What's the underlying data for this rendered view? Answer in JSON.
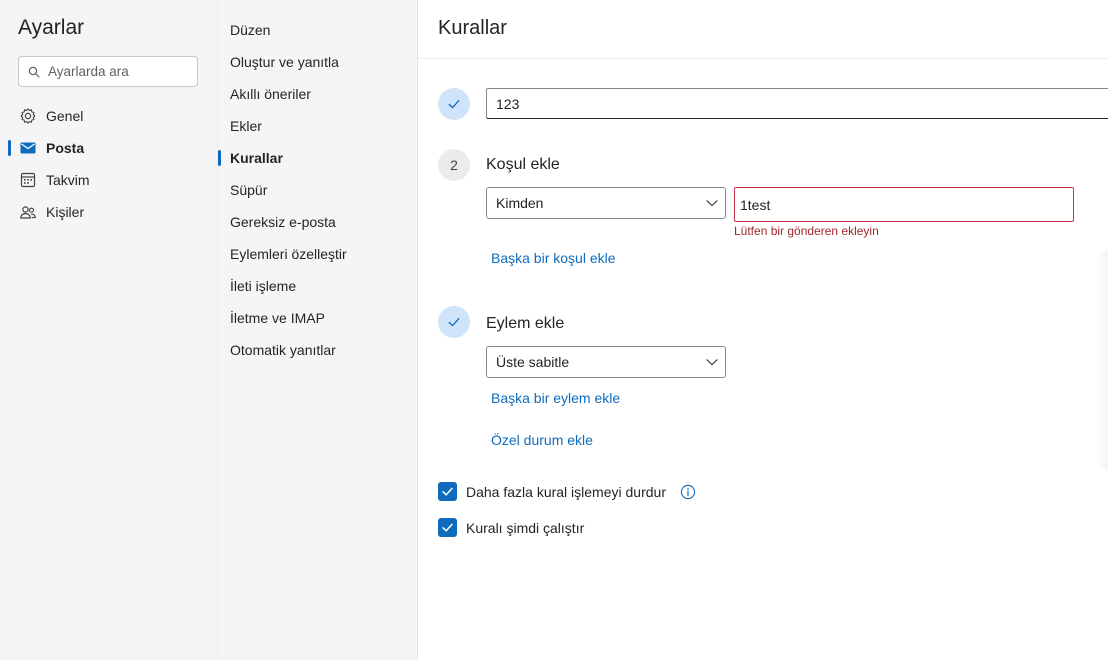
{
  "settings": {
    "title": "Ayarlar",
    "search_placeholder": "Ayarlarda ara"
  },
  "categories": [
    {
      "label": "Genel",
      "icon": "gear-icon",
      "active": false
    },
    {
      "label": "Posta",
      "icon": "mail-icon",
      "active": true
    },
    {
      "label": "Takvim",
      "icon": "calendar-icon",
      "active": false
    },
    {
      "label": "Kişiler",
      "icon": "people-icon",
      "active": false
    }
  ],
  "subnav": [
    {
      "label": "Düzen",
      "active": false
    },
    {
      "label": "Oluştur ve yanıtla",
      "active": false
    },
    {
      "label": "Akıllı öneriler",
      "active": false
    },
    {
      "label": "Ekler",
      "active": false
    },
    {
      "label": "Kurallar",
      "active": true
    },
    {
      "label": "Süpür",
      "active": false
    },
    {
      "label": "Gereksiz e-posta",
      "active": false
    },
    {
      "label": "Eylemleri özelleştir",
      "active": false
    },
    {
      "label": "İleti işleme",
      "active": false
    },
    {
      "label": "İletme ve IMAP",
      "active": false
    },
    {
      "label": "Otomatik yanıtlar",
      "active": false
    }
  ],
  "main": {
    "title": "Kurallar",
    "rule_name_value": "123",
    "condition": {
      "step_number": "2",
      "label": "Koşul ekle",
      "dropdown_value": "Kimden",
      "input_value": "1test",
      "error_text": "Lütfen bir gönderen ekleyin",
      "add_link": "Başka bir koşul ekle"
    },
    "action": {
      "label": "Eylem ekle",
      "dropdown_value": "Üste sabitle",
      "add_link": "Başka bir eylem ekle",
      "exception_link": "Özel durum ekle"
    },
    "checkboxes": [
      {
        "label": "Daha fazla kural işlemeyi durdur",
        "checked": true,
        "has_info": true
      },
      {
        "label": "Kuralı şimdi çalıştır",
        "checked": true,
        "has_info": false
      }
    ]
  },
  "colors": {
    "accent": "#0f6cbd",
    "error": "#c4314b",
    "step_done_bg": "#cfe4fa",
    "pane_bg": "#f5f5f5"
  }
}
